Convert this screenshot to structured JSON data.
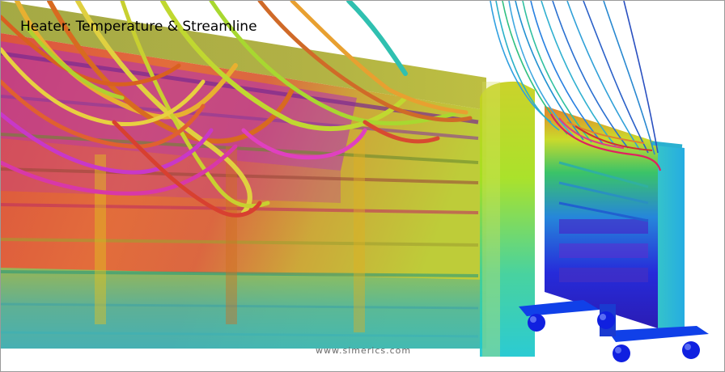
{
  "title": "Heater: Temperature & Streamline",
  "watermark": "www.simerics.com",
  "colors": {
    "hot": "#d9402a",
    "warm": "#e0a020",
    "mid": "#9acd32",
    "cool": "#22b8c8",
    "cold": "#1a1ad0",
    "fin": "#cc44cc",
    "wheel": "#1030e0"
  }
}
